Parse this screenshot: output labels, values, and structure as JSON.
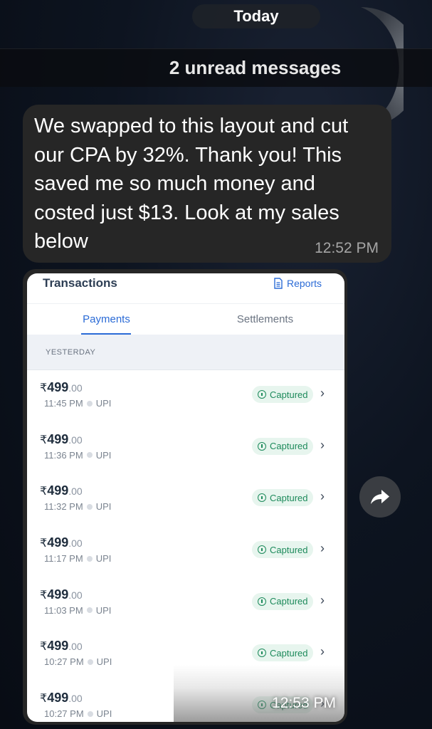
{
  "chat": {
    "date_label": "Today",
    "unread_label": "2 unread messages",
    "message": {
      "text": "We swapped to this layout and cut our CPA by 32%. Thank you! This saved me so much money and costed just $13. Look at my sales below",
      "time": "12:52 PM"
    },
    "image_message": {
      "time": "12:53 PM"
    }
  },
  "screenshot": {
    "title": "Transactions",
    "reports_label": "Reports",
    "tabs": [
      {
        "label": "Payments",
        "active": true
      },
      {
        "label": "Settlements",
        "active": false
      }
    ],
    "section_label": "YESTERDAY",
    "transactions": [
      {
        "currency": "₹",
        "amount": "499",
        "decimals": ".00",
        "time": "11:45 PM",
        "method": "UPI",
        "status": "Captured"
      },
      {
        "currency": "₹",
        "amount": "499",
        "decimals": ".00",
        "time": "11:36 PM",
        "method": "UPI",
        "status": "Captured"
      },
      {
        "currency": "₹",
        "amount": "499",
        "decimals": ".00",
        "time": "11:32 PM",
        "method": "UPI",
        "status": "Captured"
      },
      {
        "currency": "₹",
        "amount": "499",
        "decimals": ".00",
        "time": "11:17 PM",
        "method": "UPI",
        "status": "Captured"
      },
      {
        "currency": "₹",
        "amount": "499",
        "decimals": ".00",
        "time": "11:03 PM",
        "method": "UPI",
        "status": "Captured"
      },
      {
        "currency": "₹",
        "amount": "499",
        "decimals": ".00",
        "time": "10:27 PM",
        "method": "UPI",
        "status": "Captured"
      },
      {
        "currency": "₹",
        "amount": "499",
        "decimals": ".00",
        "time": "10:27 PM",
        "method": "UPI",
        "status": "Captured"
      }
    ]
  },
  "icons": {
    "forward": "forward-arrow-icon",
    "reports": "document-icon",
    "status": "info-circle-icon",
    "row_action": "chevron-right-icon"
  },
  "colors": {
    "accent": "#2b6bd6",
    "captured": "#1d8a5b",
    "bubble": "#262626"
  }
}
